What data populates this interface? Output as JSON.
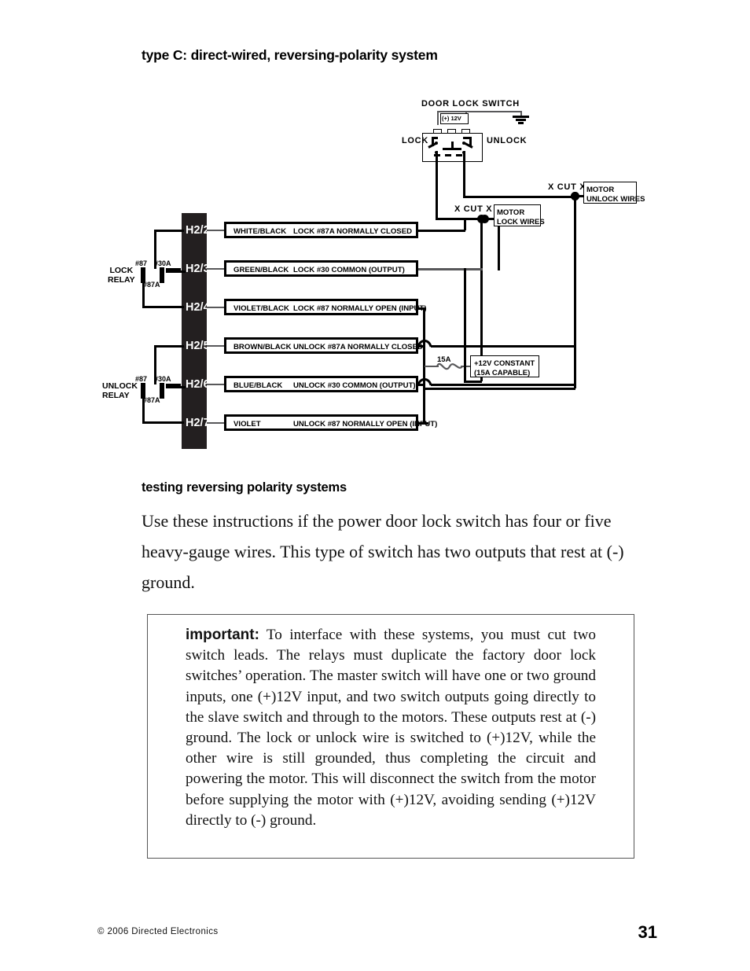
{
  "page": {
    "section_title": "type C: direct-wired, reversing-polarity system",
    "subsection_title": "testing reversing polarity systems",
    "intro_paragraph": "Use these instructions if the power door lock switch has four or five heavy-gauge wires. This type of switch has two outputs that rest at (-) ground.",
    "important": {
      "lead": "important:",
      "body": " To interface with these systems, you must cut two switch leads. The relays must duplicate the factory door lock switches’ operation. The master switch will have one or two ground inputs, one (+)12V input, and two switch outputs going directly to the slave switch and through to the motors. These outputs rest at (-) ground. The lock or unlock wire is switched to (+)12V, while the other wire is still grounded, thus completing the circuit and powering the motor. This will disconnect the switch from the motor before supplying the motor with (+)12V, avoiding sending (+)12V directly to (-) ground."
    },
    "footer": {
      "copyright": "© 2006 Directed Electronics",
      "page_number": "31"
    }
  },
  "diagram": {
    "door_lock_switch_label": "DOOR LOCK SWITCH",
    "power_label": "(+) 12V",
    "lock_label": "LOCK",
    "unlock_label": "UNLOCK",
    "cut_marks": [
      "X CUT X",
      "X CUT X"
    ],
    "motor_lock_wires": "MOTOR\nLOCK WIRES",
    "motor_unlock_wires": "MOTOR\nUNLOCK WIRES",
    "fuse_label": "15A",
    "constant_box": "+12V CONSTANT\n(15A CAPABLE)",
    "relays": [
      {
        "name": "LOCK\nRELAY",
        "terminals": [
          "#87",
          "#30A",
          "#87A"
        ]
      },
      {
        "name": "UNLOCK\nRELAY",
        "terminals": [
          "#87",
          "#30A",
          "#87A"
        ]
      }
    ],
    "connector_rows": [
      {
        "pin": "H2/2",
        "wire_color": "WHITE/BLACK",
        "function": "LOCK #87A NORMALLY CLOSED"
      },
      {
        "pin": "H2/3",
        "wire_color": "GREEN/BLACK",
        "function": "LOCK #30 COMMON (OUTPUT)"
      },
      {
        "pin": "H2/4",
        "wire_color": "VIOLET/BLACK",
        "function": "LOCK #87 NORMALLY OPEN (INPUT)"
      },
      {
        "pin": "H2/5",
        "wire_color": "BROWN/BLACK",
        "function": "UNLOCK #87A NORMALLY CLOSED"
      },
      {
        "pin": "H2/6",
        "wire_color": "BLUE/BLACK",
        "function": "UNLOCK #30 COMMON (OUTPUT)"
      },
      {
        "pin": "H2/7",
        "wire_color": "VIOLET",
        "function": "UNLOCK #87 NORMALLY OPEN (INPUT)"
      }
    ]
  }
}
